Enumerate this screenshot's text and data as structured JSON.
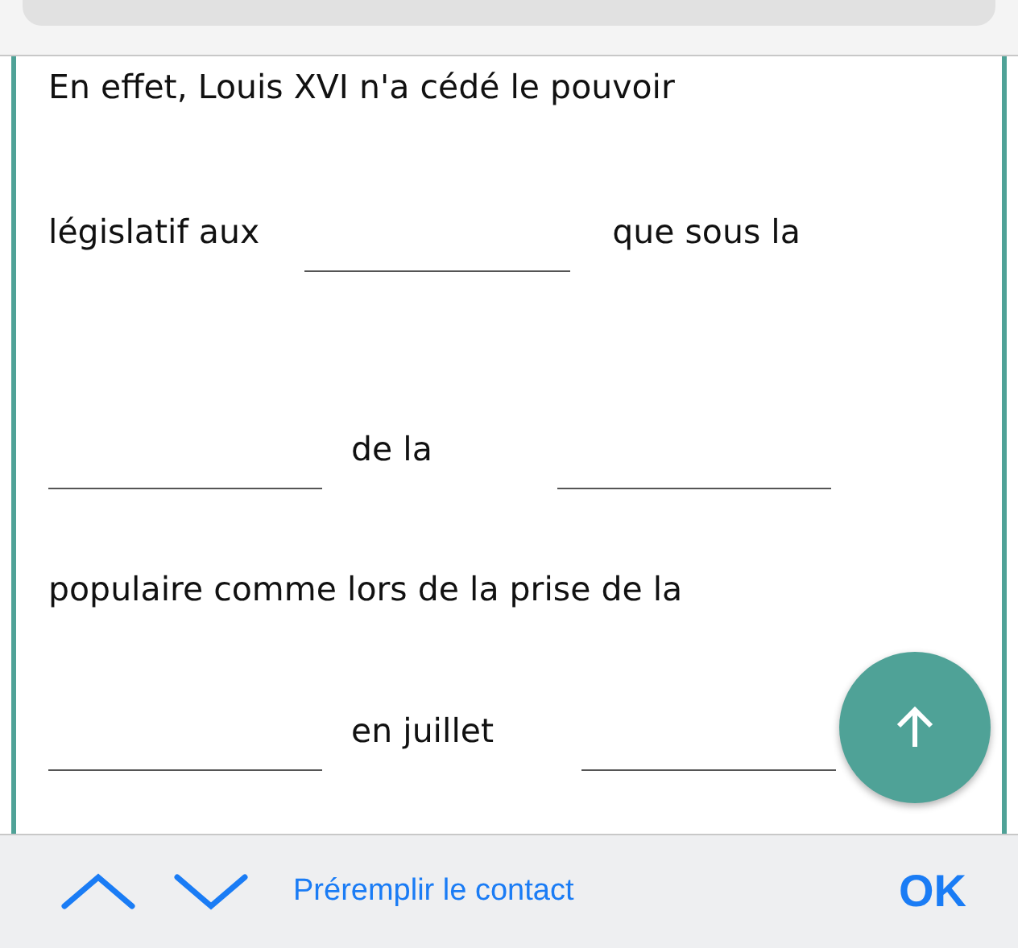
{
  "lines": [
    [
      {
        "kind": "text",
        "text": "En effet, Louis XVI n'a cédé le pouvoir"
      }
    ],
    [
      {
        "kind": "text",
        "text": "législatif aux"
      },
      {
        "kind": "blank"
      },
      {
        "kind": "text",
        "text": "que sous la"
      }
    ],
    [
      {
        "kind": "blank"
      },
      {
        "kind": "text",
        "text": "de la"
      },
      {
        "kind": "blank"
      }
    ],
    [
      {
        "kind": "text",
        "text": "populaire comme lors de la prise de la"
      }
    ],
    [
      {
        "kind": "blank"
      },
      {
        "kind": "text",
        "text": "en juillet"
      },
      {
        "kind": "blank"
      }
    ]
  ],
  "toolbar": {
    "link": "Préremplir le contact",
    "done": "OK"
  }
}
